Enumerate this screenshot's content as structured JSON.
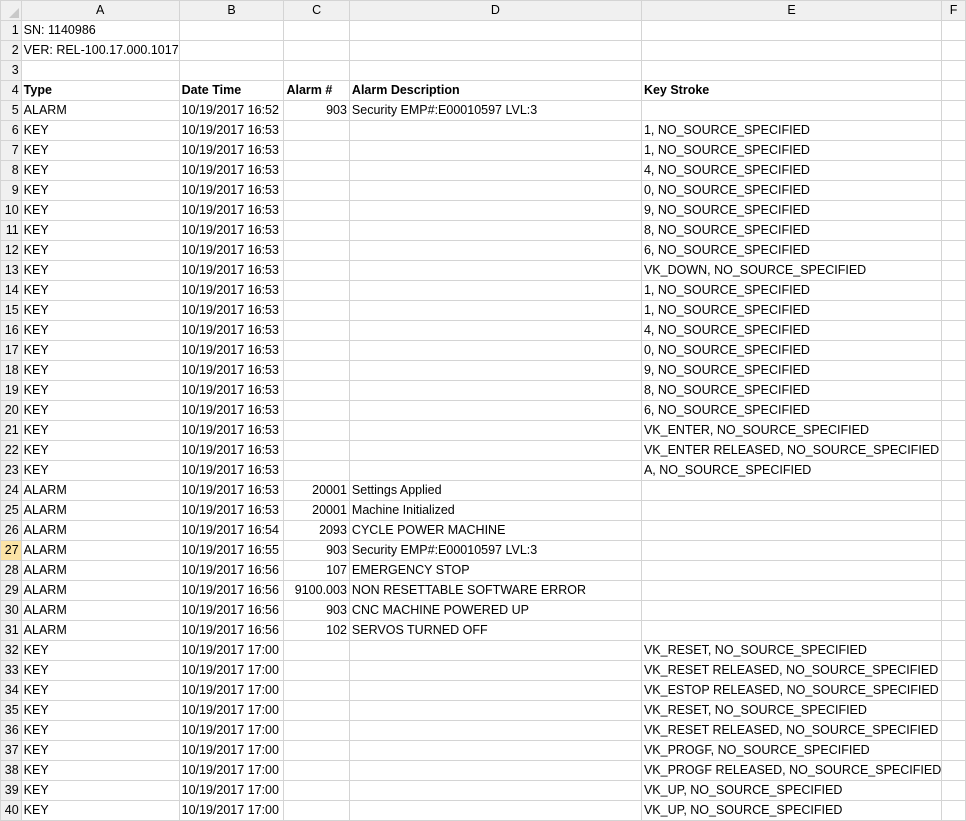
{
  "columns": [
    "A",
    "B",
    "C",
    "D",
    "E",
    "F"
  ],
  "active_row": 27,
  "rows": [
    {
      "n": 1,
      "a": "SN: 1140986",
      "b": "",
      "c": "",
      "d": "",
      "e": ""
    },
    {
      "n": 2,
      "a": "VER: REL-100.17.000.1017",
      "b": "",
      "c": "",
      "d": "",
      "e": ""
    },
    {
      "n": 3,
      "a": "",
      "b": "",
      "c": "",
      "d": "",
      "e": ""
    },
    {
      "n": 4,
      "a": "Type",
      "b": "Date Time",
      "c": "Alarm #",
      "d": "Alarm Description",
      "e": "Key Stroke",
      "header": true
    },
    {
      "n": 5,
      "a": "ALARM",
      "b": "10/19/2017 16:52",
      "c": "903",
      "d": "Security EMP#:E00010597 LVL:3",
      "e": ""
    },
    {
      "n": 6,
      "a": "KEY",
      "b": "10/19/2017 16:53",
      "c": "",
      "d": "",
      "e": "1, NO_SOURCE_SPECIFIED"
    },
    {
      "n": 7,
      "a": "KEY",
      "b": "10/19/2017 16:53",
      "c": "",
      "d": "",
      "e": "1, NO_SOURCE_SPECIFIED"
    },
    {
      "n": 8,
      "a": "KEY",
      "b": "10/19/2017 16:53",
      "c": "",
      "d": "",
      "e": "4, NO_SOURCE_SPECIFIED"
    },
    {
      "n": 9,
      "a": "KEY",
      "b": "10/19/2017 16:53",
      "c": "",
      "d": "",
      "e": "0, NO_SOURCE_SPECIFIED"
    },
    {
      "n": 10,
      "a": "KEY",
      "b": "10/19/2017 16:53",
      "c": "",
      "d": "",
      "e": "9, NO_SOURCE_SPECIFIED"
    },
    {
      "n": 11,
      "a": "KEY",
      "b": "10/19/2017 16:53",
      "c": "",
      "d": "",
      "e": "8, NO_SOURCE_SPECIFIED"
    },
    {
      "n": 12,
      "a": "KEY",
      "b": "10/19/2017 16:53",
      "c": "",
      "d": "",
      "e": "6, NO_SOURCE_SPECIFIED"
    },
    {
      "n": 13,
      "a": "KEY",
      "b": "10/19/2017 16:53",
      "c": "",
      "d": "",
      "e": "VK_DOWN, NO_SOURCE_SPECIFIED"
    },
    {
      "n": 14,
      "a": "KEY",
      "b": "10/19/2017 16:53",
      "c": "",
      "d": "",
      "e": "1, NO_SOURCE_SPECIFIED"
    },
    {
      "n": 15,
      "a": "KEY",
      "b": "10/19/2017 16:53",
      "c": "",
      "d": "",
      "e": "1, NO_SOURCE_SPECIFIED"
    },
    {
      "n": 16,
      "a": "KEY",
      "b": "10/19/2017 16:53",
      "c": "",
      "d": "",
      "e": "4, NO_SOURCE_SPECIFIED"
    },
    {
      "n": 17,
      "a": "KEY",
      "b": "10/19/2017 16:53",
      "c": "",
      "d": "",
      "e": "0, NO_SOURCE_SPECIFIED"
    },
    {
      "n": 18,
      "a": "KEY",
      "b": "10/19/2017 16:53",
      "c": "",
      "d": "",
      "e": "9, NO_SOURCE_SPECIFIED"
    },
    {
      "n": 19,
      "a": "KEY",
      "b": "10/19/2017 16:53",
      "c": "",
      "d": "",
      "e": "8, NO_SOURCE_SPECIFIED"
    },
    {
      "n": 20,
      "a": "KEY",
      "b": "10/19/2017 16:53",
      "c": "",
      "d": "",
      "e": "6, NO_SOURCE_SPECIFIED"
    },
    {
      "n": 21,
      "a": "KEY",
      "b": "10/19/2017 16:53",
      "c": "",
      "d": "",
      "e": "VK_ENTER, NO_SOURCE_SPECIFIED"
    },
    {
      "n": 22,
      "a": "KEY",
      "b": "10/19/2017 16:53",
      "c": "",
      "d": "",
      "e": "VK_ENTER RELEASED, NO_SOURCE_SPECIFIED"
    },
    {
      "n": 23,
      "a": "KEY",
      "b": "10/19/2017 16:53",
      "c": "",
      "d": "",
      "e": "A, NO_SOURCE_SPECIFIED"
    },
    {
      "n": 24,
      "a": "ALARM",
      "b": "10/19/2017 16:53",
      "c": "20001",
      "d": "Settings Applied",
      "e": ""
    },
    {
      "n": 25,
      "a": "ALARM",
      "b": "10/19/2017 16:53",
      "c": "20001",
      "d": "Machine Initialized",
      "e": ""
    },
    {
      "n": 26,
      "a": "ALARM",
      "b": "10/19/2017 16:54",
      "c": "2093",
      "d": "CYCLE POWER MACHINE",
      "e": ""
    },
    {
      "n": 27,
      "a": "ALARM",
      "b": "10/19/2017 16:55",
      "c": "903",
      "d": "Security EMP#:E00010597 LVL:3",
      "e": ""
    },
    {
      "n": 28,
      "a": "ALARM",
      "b": "10/19/2017 16:56",
      "c": "107",
      "d": "EMERGENCY STOP",
      "e": ""
    },
    {
      "n": 29,
      "a": "ALARM",
      "b": "10/19/2017 16:56",
      "c": "9100.003",
      "d": "NON RESETTABLE SOFTWARE ERROR",
      "e": ""
    },
    {
      "n": 30,
      "a": "ALARM",
      "b": "10/19/2017 16:56",
      "c": "903",
      "d": "CNC MACHINE POWERED UP",
      "e": ""
    },
    {
      "n": 31,
      "a": "ALARM",
      "b": "10/19/2017 16:56",
      "c": "102",
      "d": "SERVOS TURNED OFF",
      "e": ""
    },
    {
      "n": 32,
      "a": "KEY",
      "b": "10/19/2017 17:00",
      "c": "",
      "d": "",
      "e": "VK_RESET, NO_SOURCE_SPECIFIED"
    },
    {
      "n": 33,
      "a": "KEY",
      "b": "10/19/2017 17:00",
      "c": "",
      "d": "",
      "e": "VK_RESET RELEASED, NO_SOURCE_SPECIFIED"
    },
    {
      "n": 34,
      "a": "KEY",
      "b": "10/19/2017 17:00",
      "c": "",
      "d": "",
      "e": "VK_ESTOP RELEASED, NO_SOURCE_SPECIFIED"
    },
    {
      "n": 35,
      "a": "KEY",
      "b": "10/19/2017 17:00",
      "c": "",
      "d": "",
      "e": "VK_RESET, NO_SOURCE_SPECIFIED"
    },
    {
      "n": 36,
      "a": "KEY",
      "b": "10/19/2017 17:00",
      "c": "",
      "d": "",
      "e": "VK_RESET RELEASED, NO_SOURCE_SPECIFIED"
    },
    {
      "n": 37,
      "a": "KEY",
      "b": "10/19/2017 17:00",
      "c": "",
      "d": "",
      "e": "VK_PROGF, NO_SOURCE_SPECIFIED"
    },
    {
      "n": 38,
      "a": "KEY",
      "b": "10/19/2017 17:00",
      "c": "",
      "d": "",
      "e": "VK_PROGF RELEASED, NO_SOURCE_SPECIFIED"
    },
    {
      "n": 39,
      "a": "KEY",
      "b": "10/19/2017 17:00",
      "c": "",
      "d": "",
      "e": "VK_UP, NO_SOURCE_SPECIFIED"
    },
    {
      "n": 40,
      "a": "KEY",
      "b": "10/19/2017 17:00",
      "c": "",
      "d": "",
      "e": "VK_UP, NO_SOURCE_SPECIFIED"
    }
  ]
}
